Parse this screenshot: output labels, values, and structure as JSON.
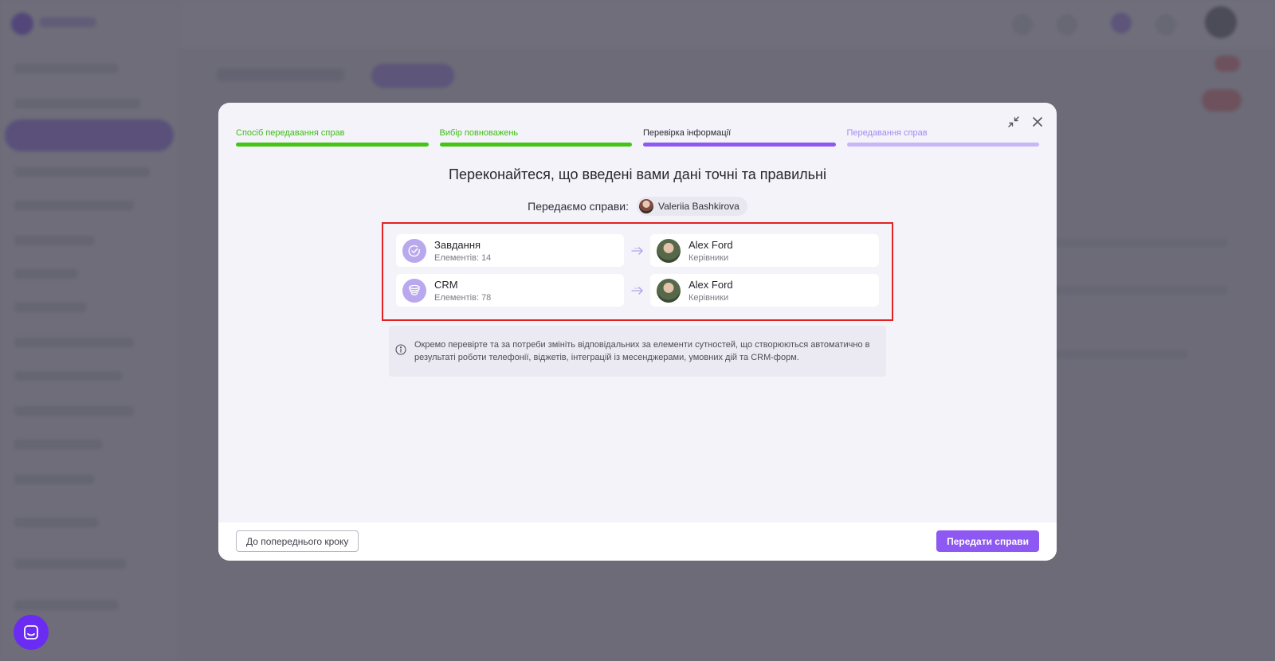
{
  "stepper": [
    {
      "label": "Спосіб передавання справ",
      "state": "done"
    },
    {
      "label": "Вибір повноважень",
      "state": "done"
    },
    {
      "label": "Перевірка інформації",
      "state": "active"
    },
    {
      "label": "Передавання справ",
      "state": "todo"
    }
  ],
  "window": {
    "minimize_icon": "collapse-arrows-icon",
    "close_icon": "close-icon"
  },
  "headline": "Переконайтеся, що введені вами дані точні та правильні",
  "transfer": {
    "label": "Передаємо справи:",
    "user_name": "Valeriia Bashkirova"
  },
  "mappings": [
    {
      "entity": "Завдання",
      "count_text": "Елементів: 14",
      "icon": "task-check-icon",
      "assignee": "Alex Ford",
      "role": "Керівники"
    },
    {
      "entity": "CRM",
      "count_text": "Елементів: 78",
      "icon": "crm-funnel-icon",
      "assignee": "Alex Ford",
      "role": "Керівники"
    }
  ],
  "info_note": "Окремо перевірте та за потреби змініть відповідальних за елементи сутностей, що створюються автоматично в результаті роботи телефонії, віджетів, інтеграцій із месенджерами, умовних дій та CRM-форм.",
  "footer": {
    "back_label": "До попереднього кроку",
    "submit_label": "Передати справи"
  },
  "colors": {
    "accent": "#8e58f2",
    "done": "#45c415",
    "highlight": "#e32121"
  }
}
